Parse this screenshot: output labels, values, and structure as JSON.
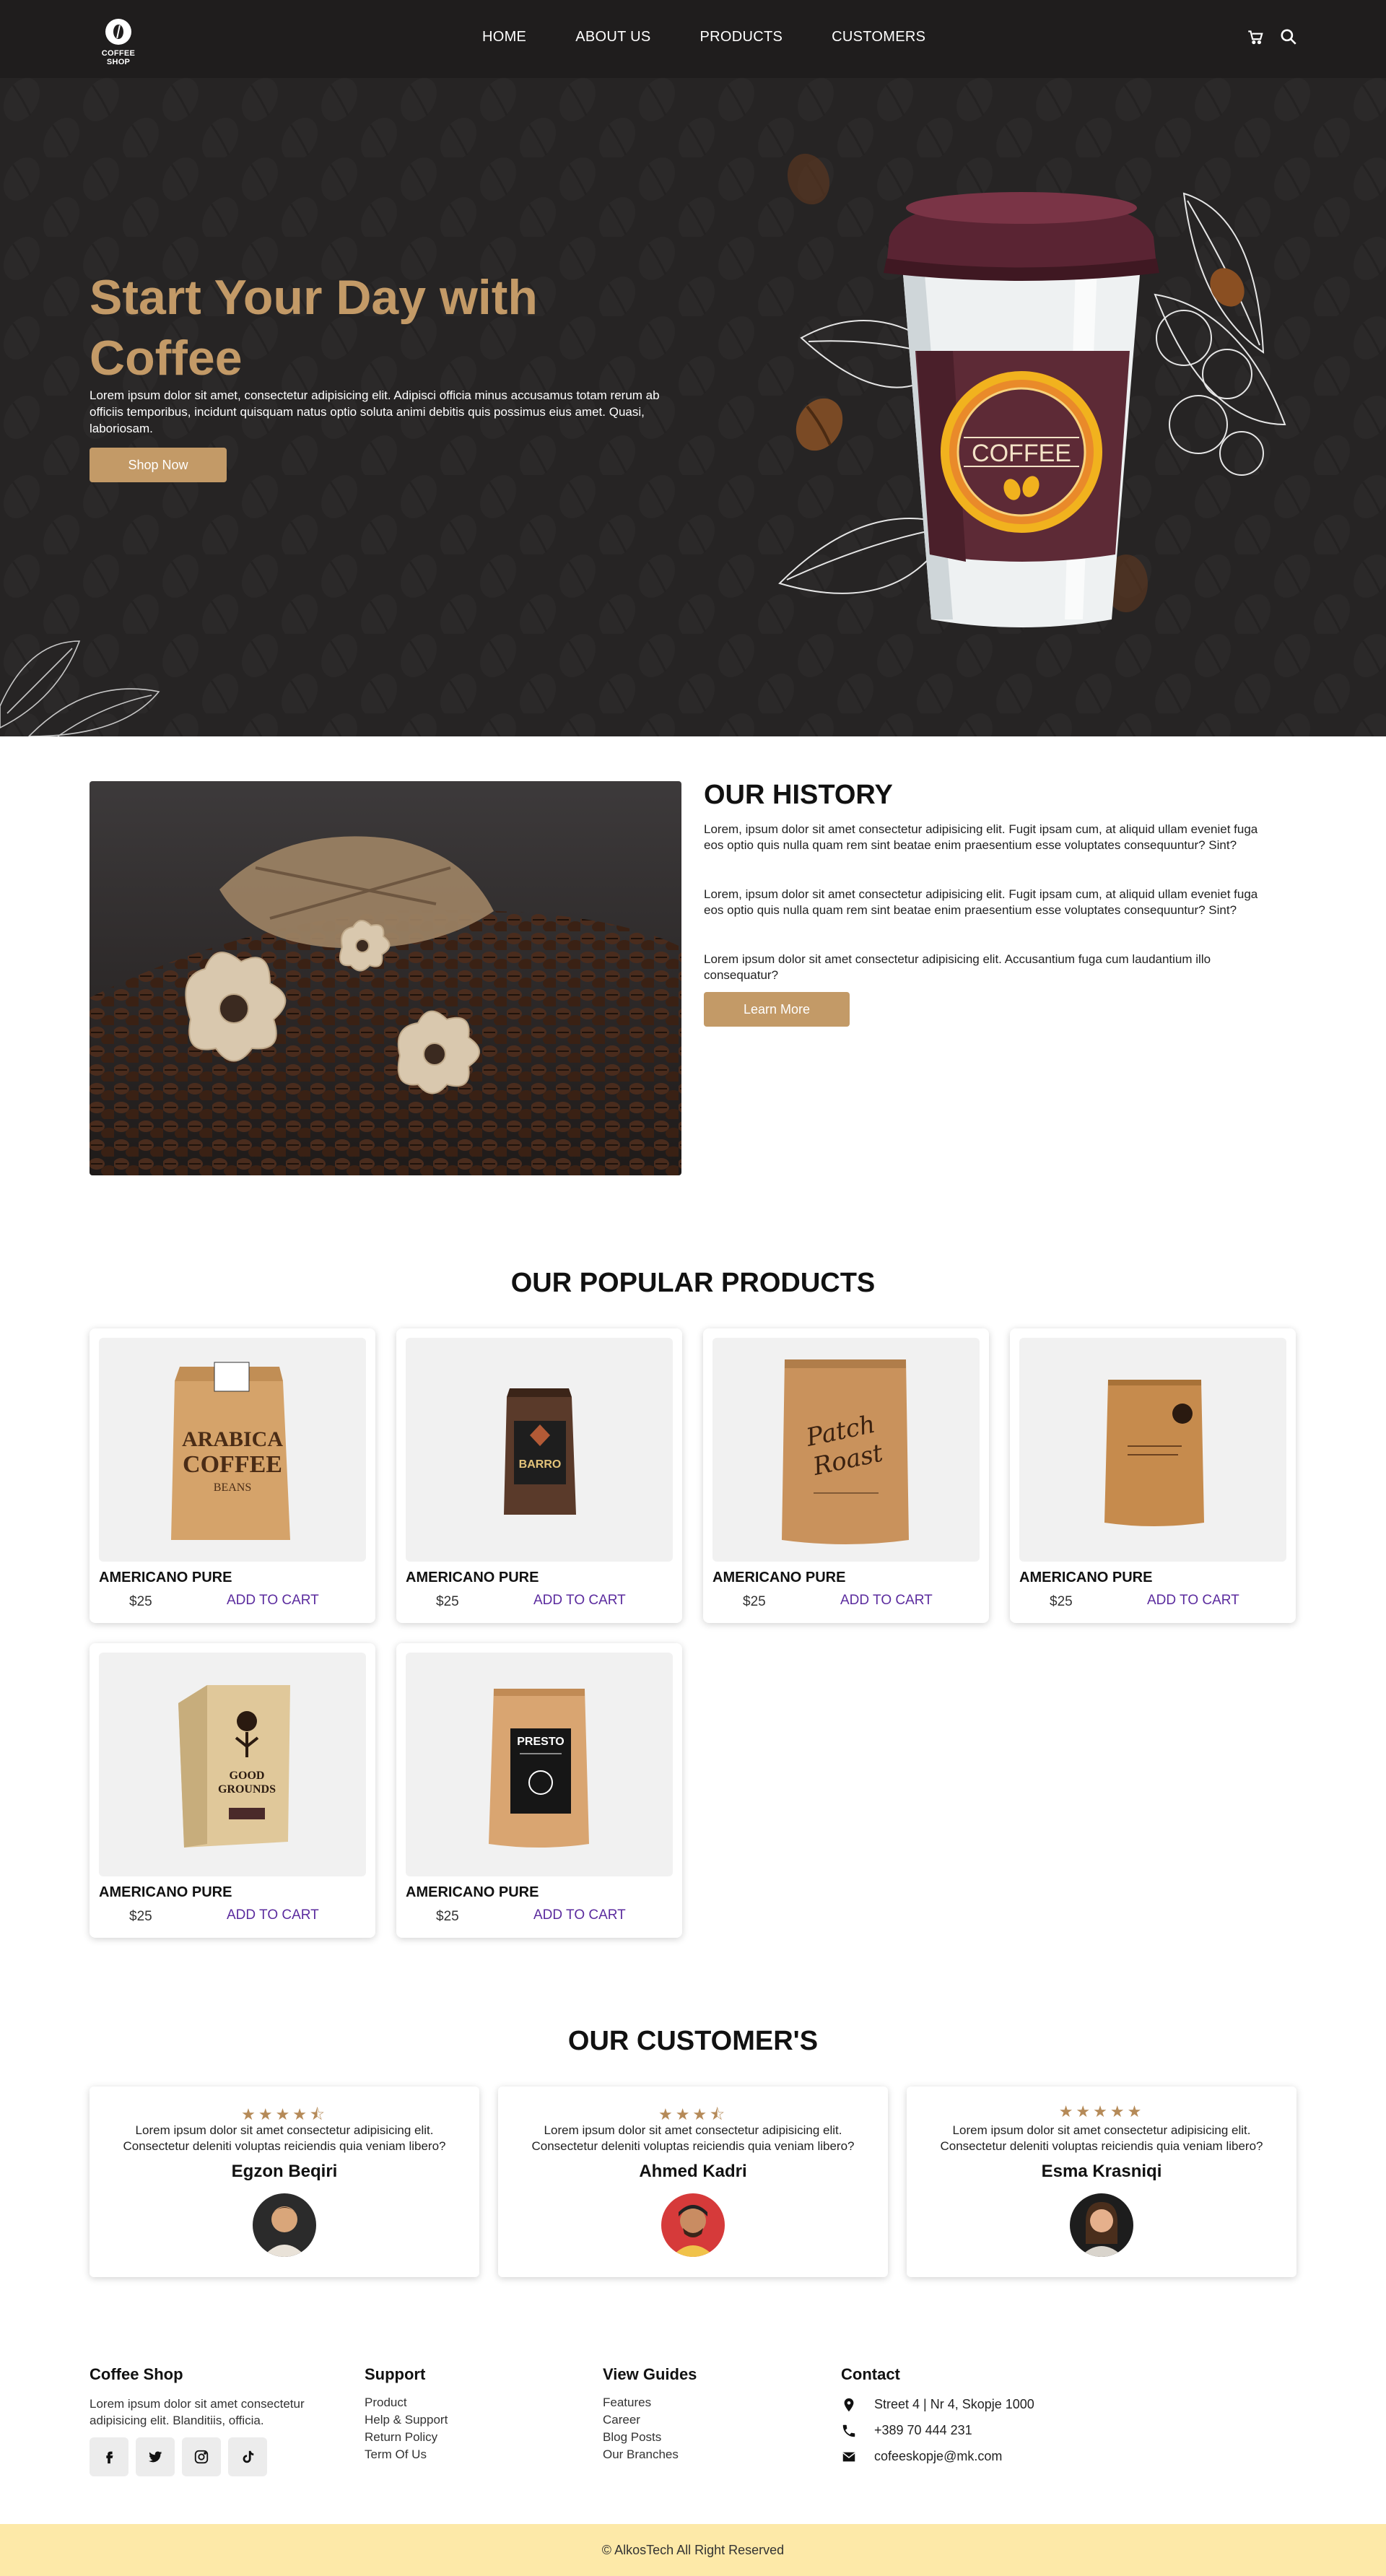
{
  "brand": {
    "name": "COFFEE SHOP"
  },
  "nav": {
    "items": [
      {
        "label": "HOME"
      },
      {
        "label": "ABOUT US"
      },
      {
        "label": "PRODUCTS"
      },
      {
        "label": "CUSTOMERS"
      }
    ],
    "icons": [
      "cart-icon",
      "search-icon"
    ]
  },
  "hero": {
    "title": "Start Your Day with Coffee",
    "text": "Lorem ipsum dolor sit amet, consectetur adipisicing elit. Adipisci officia minus accusamus totam rerum ab officiis temporibus, incidunt quisquam natus optio soluta animi debitis quis possimus eius amet. Quasi, laboriosam.",
    "button": "Shop Now",
    "cup_label": "COFFEE"
  },
  "history": {
    "title": "OUR HISTORY",
    "p1": "Lorem, ipsum dolor sit amet consectetur adipisicing elit. Fugit ipsam cum, at aliquid ullam eveniet fuga eos optio quis nulla quam rem sint beatae enim praesentium esse voluptates consequuntur? Sint?",
    "p2": "Lorem, ipsum dolor sit amet consectetur adipisicing elit. Fugit ipsam cum, at aliquid ullam eveniet fuga eos optio quis nulla quam rem sint beatae enim praesentium esse voluptates consequuntur? Sint?",
    "p3": "Lorem ipsum dolor sit amet consectetur adipisicing elit. Accusantium fuga cum laudantium illo consequatur?",
    "button": "Learn More"
  },
  "products": {
    "title": "OUR POPULAR PRODUCTS",
    "items": [
      {
        "name": "AMERICANO PURE",
        "price": "$25",
        "cta": "ADD TO CART",
        "bag_text": "ARABICA COFFEE"
      },
      {
        "name": "AMERICANO PURE",
        "price": "$25",
        "cta": "ADD TO CART",
        "bag_text": "BARRO"
      },
      {
        "name": "AMERICANO PURE",
        "price": "$25",
        "cta": "ADD TO CART",
        "bag_text": "Patch Roast"
      },
      {
        "name": "AMERICANO PURE",
        "price": "$25",
        "cta": "ADD TO CART",
        "bag_text": ""
      },
      {
        "name": "AMERICANO PURE",
        "price": "$25",
        "cta": "ADD TO CART",
        "bag_text": "GOOD GROUNDS"
      },
      {
        "name": "AMERICANO PURE",
        "price": "$25",
        "cta": "ADD TO CART",
        "bag_text": "PRESTO"
      }
    ]
  },
  "customers": {
    "title": "OUR CUSTOMER'S",
    "reviews": [
      {
        "stars": "★★★★⯪",
        "text": "Lorem ipsum dolor sit amet consectetur adipisicing elit. Consectetur deleniti voluptas reiciendis quia veniam libero?",
        "name": "Egzon Beqiri"
      },
      {
        "stars": "★★★⯪",
        "text": "Lorem ipsum dolor sit amet consectetur adipisicing elit. Consectetur deleniti voluptas reiciendis quia veniam libero?",
        "name": "Ahmed Kadri"
      },
      {
        "stars": "★★★★★",
        "text": "Lorem ipsum dolor sit amet consectetur adipisicing elit. Consectetur deleniti voluptas reiciendis quia veniam libero?",
        "name": "Esma Krasniqi"
      }
    ]
  },
  "footer": {
    "about": {
      "title": "Coffee Shop",
      "text": "Lorem ipsum dolor sit amet consectetur adipisicing elit. Blanditiis, officia."
    },
    "social": [
      "facebook-icon",
      "twitter-icon",
      "instagram-icon",
      "tiktok-icon"
    ],
    "support": {
      "title": "Support",
      "links": [
        "Product",
        "Help & Support",
        "Return Policy",
        "Term Of Us"
      ]
    },
    "guides": {
      "title": "View Guides",
      "links": [
        "Features",
        "Career",
        "Blog Posts",
        "Our Branches"
      ]
    },
    "contact": {
      "title": "Contact",
      "address": "Street 4 | Nr 4, Skopje 1000",
      "phone": "+389 70 444 231",
      "email": "cofeeskopje@mk.com"
    },
    "copyright": "© AlkosTech All Right Reserved"
  },
  "colors": {
    "nav_bg": "#1f1d1d",
    "hero_bg": "#262424",
    "accent": "#c39a67",
    "link": "#5b2b9e",
    "copyright_bg": "#fde9a8"
  }
}
